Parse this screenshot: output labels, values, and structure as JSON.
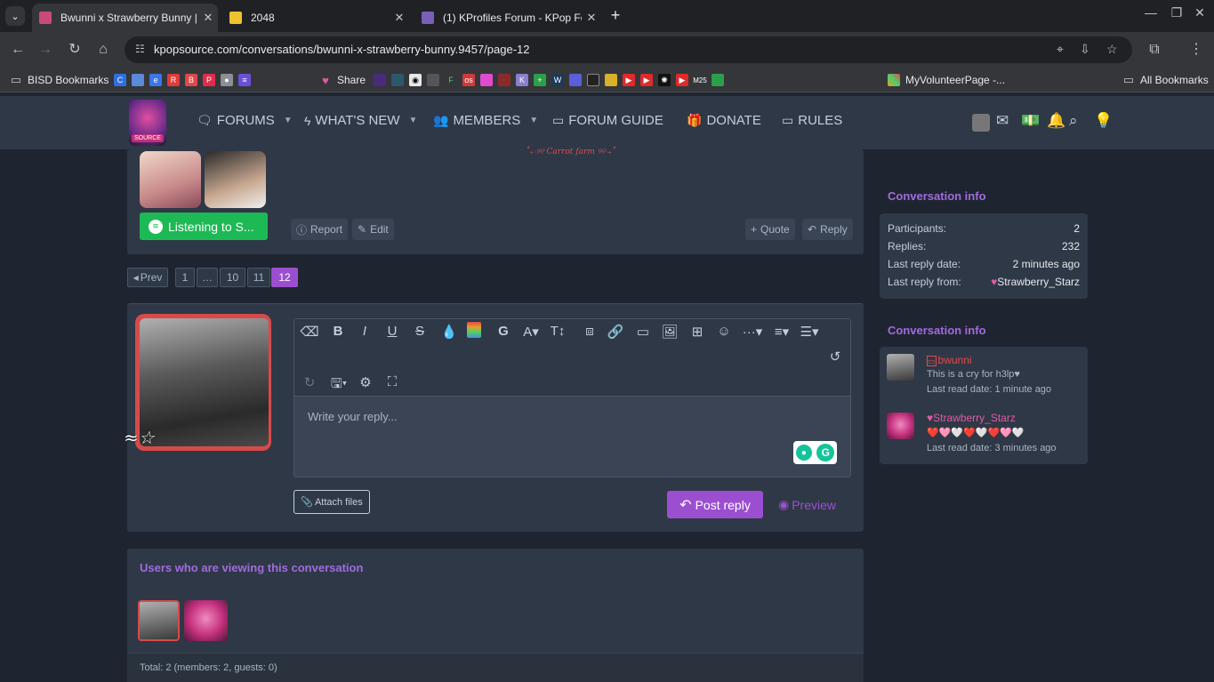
{
  "browser": {
    "tabs": [
      {
        "title": "Bwunni x Strawberry Bunny | K",
        "active": true
      },
      {
        "title": "2048",
        "active": false
      },
      {
        "title": "(1) KProfiles Forum - KPop For",
        "active": false
      }
    ],
    "url": "kpopsource.com/conversations/bwunni-x-strawberry-bunny.9457/page-12",
    "bookmarks": [
      {
        "label": "BISD Bookmarks"
      },
      {
        "label": "Share"
      },
      {
        "label": "MyVolunteerPage -..."
      },
      {
        "label": "All Bookmarks"
      }
    ]
  },
  "nav": {
    "logo_text": "SOURCE",
    "items": [
      {
        "label": "FORUMS",
        "icon": "chat-icon"
      },
      {
        "label": "WHAT'S NEW",
        "icon": "bolt-icon"
      },
      {
        "label": "MEMBERS",
        "icon": "users-icon"
      },
      {
        "label": "FORUM GUIDE",
        "icon": "folder-icon"
      },
      {
        "label": "DONATE",
        "icon": "gift-icon"
      },
      {
        "label": "RULES",
        "icon": "folder-icon"
      }
    ]
  },
  "post": {
    "signature_text": "˚₊‧୨୧ Carrot farm ୨୧‧₊˚",
    "listening_label": "Listening to S...",
    "report_label": "Report",
    "edit_label": "Edit",
    "quote_label": "Quote",
    "reply_label": "Reply"
  },
  "pagination": {
    "prev_label": "Prev",
    "pages": [
      "1",
      "…",
      "10",
      "11",
      "12"
    ],
    "current": "12"
  },
  "reply_form": {
    "placeholder": "Write your reply...",
    "attach_label": "Attach files",
    "post_label": "Post reply",
    "preview_label": "Preview"
  },
  "viewers": {
    "heading": "Users who are viewing this conversation",
    "total": "Total: 2 (members: 2, guests: 0)"
  },
  "sidebar": {
    "info_heading": "Conversation info",
    "info": [
      {
        "key": "Participants:",
        "value": "2"
      },
      {
        "key": "Replies:",
        "value": "232"
      },
      {
        "key": "Last reply date:",
        "value": "2 minutes ago"
      },
      {
        "key": "Last reply from:",
        "value": "Strawberry_Starz"
      }
    ],
    "participants_heading": "Conversation info",
    "participants": [
      {
        "name": "bwunni",
        "status": "This is a cry for h3lp♥",
        "last_read": "Last read date: 1 minute ago"
      },
      {
        "name": "Strawberry_Starz",
        "status": "❤️🩷🤍❤️🤍❤️🩷🤍",
        "last_read": "Last read date: 3 minutes ago"
      }
    ]
  },
  "colors": {
    "accent": "#9b4fd0",
    "green": "#1db954",
    "pink": "#e05aa6",
    "red": "#e04b4b"
  }
}
